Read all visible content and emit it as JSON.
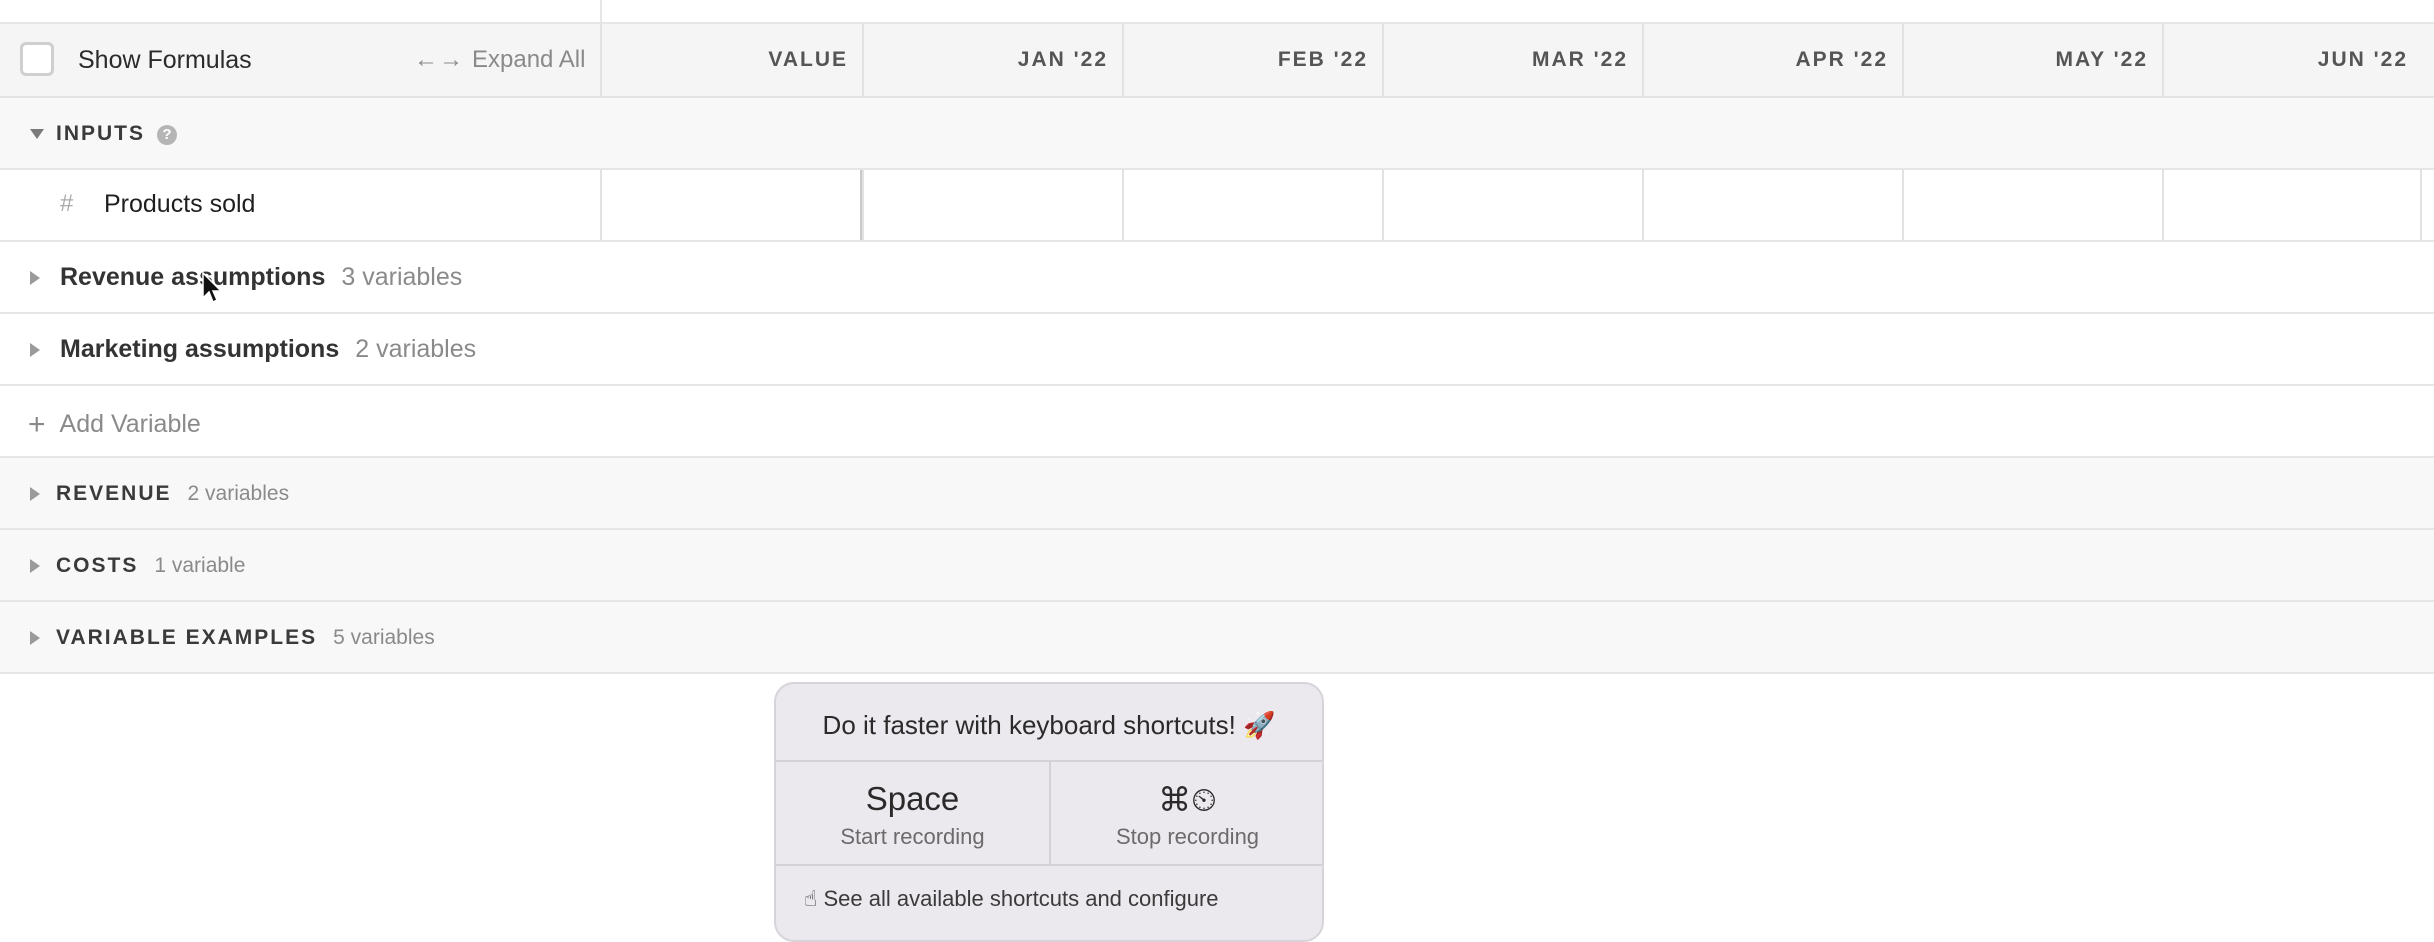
{
  "toolbar": {
    "show_formulas_label": "Show Formulas",
    "expand_all_arrows": "←→",
    "expand_all_label": "Expand All"
  },
  "columns": [
    "VALUE",
    "JAN '22",
    "FEB '22",
    "MAR '22",
    "APR '22",
    "MAY '22",
    "JUN '22"
  ],
  "inputs_section": {
    "label": "INPUTS",
    "help_glyph": "?",
    "variable": {
      "hash_glyph": "#",
      "name": "Products sold"
    }
  },
  "groups": [
    {
      "label": "Revenue assumptions",
      "count": "3 variables"
    },
    {
      "label": "Marketing assumptions",
      "count": "2 variables"
    }
  ],
  "add_variable": {
    "plus": "+",
    "label": "Add Variable"
  },
  "sections": [
    {
      "label": "REVENUE",
      "count": "2 variables"
    },
    {
      "label": "COSTS",
      "count": "1 variable"
    },
    {
      "label": "VARIABLE EXAMPLES",
      "count": "5 variables"
    }
  ],
  "popup": {
    "title": "Do it faster with keyboard shortcuts! 🚀",
    "shortcuts": [
      {
        "key": "Space",
        "desc": "Start recording"
      },
      {
        "key": "⌘⏲",
        "desc": "Stop recording"
      }
    ],
    "footer": "☝ See all available shortcuts and configure"
  },
  "colors": {
    "header_bg": "#f5f5f5",
    "popup_bg": "#ece9ee",
    "muted_text": "#8a8a8a"
  }
}
